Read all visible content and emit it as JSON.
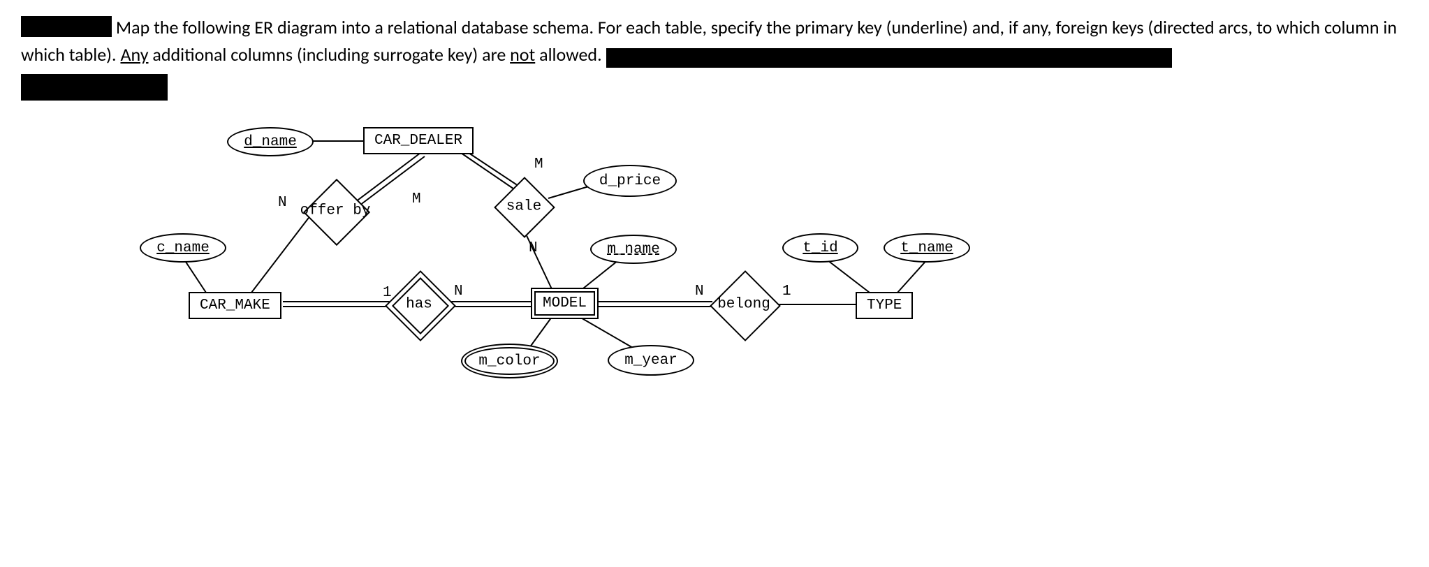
{
  "question": {
    "text_before_redact": "Map the following ER diagram into a relational database schema.  For each table, specify the primary key (underline) and, if any, foreign keys (directed arcs, to which column in which table).  ",
    "any_word": "Any",
    "text_after_any": " additional columns (including surrogate key) are ",
    "not_word": "not",
    "text_after_not": " allowed. "
  },
  "diagram": {
    "entities": {
      "car_dealer": "CAR_DEALER",
      "car_make": "CAR_MAKE",
      "model": "MODEL",
      "type": "TYPE"
    },
    "attributes": {
      "d_name": "d_name",
      "c_name": "c_name",
      "d_price": "d_price",
      "m_name": "m_name",
      "m_color": "m_color",
      "m_year": "m_year",
      "t_id": "t_id",
      "t_name": "t_name"
    },
    "relationships": {
      "offer_by": "offer by",
      "sale": "sale",
      "has": "has",
      "belong": "belong"
    },
    "cardinalities": {
      "offer_by_make": "N",
      "offer_by_dealer": "M",
      "sale_dealer": "M",
      "sale_model": "N",
      "has_make": "1",
      "has_model": "N",
      "belong_model": "N",
      "belong_type": "1"
    }
  }
}
